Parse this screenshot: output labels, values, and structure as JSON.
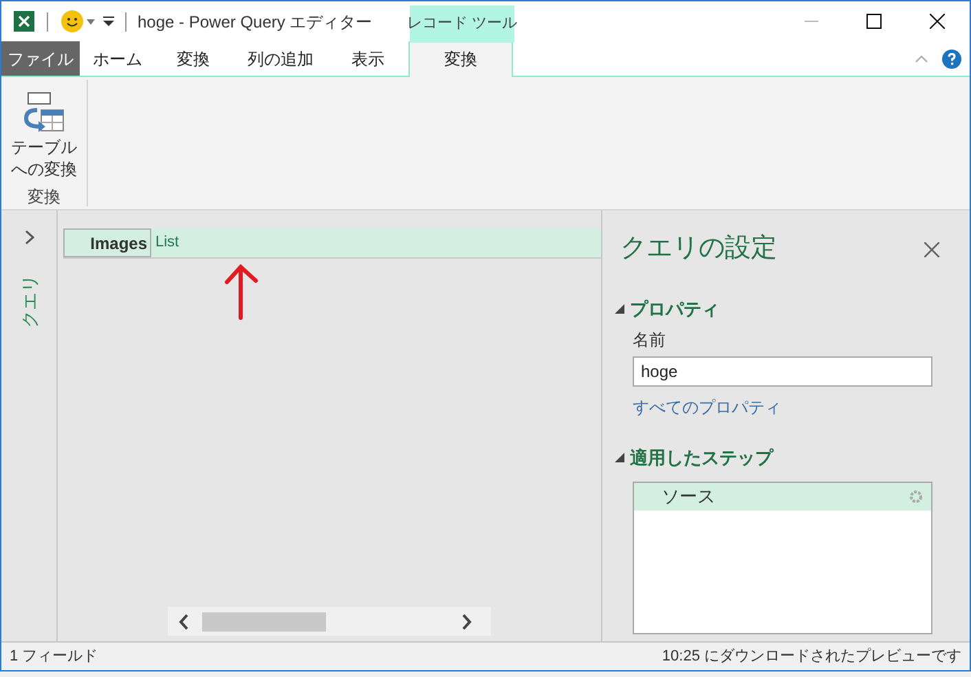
{
  "window": {
    "title": "hoge - Power Query エディター",
    "context_tab": "レコード ツール"
  },
  "tabs": [
    {
      "label": "ファイル",
      "kind": "file",
      "selected": false
    },
    {
      "label": "ホーム",
      "kind": "tab",
      "selected": false
    },
    {
      "label": "変換",
      "kind": "tab",
      "selected": false
    },
    {
      "label": "列の追加",
      "kind": "tab",
      "selected": false
    },
    {
      "label": "表示",
      "kind": "tab",
      "selected": false
    },
    {
      "label": "変換",
      "kind": "context",
      "selected": true
    }
  ],
  "ribbon": {
    "buttons": [
      {
        "lines": [
          "テーブル",
          "への変換"
        ]
      }
    ],
    "group_label": "変換"
  },
  "queries_pane": {
    "label": "クエリ"
  },
  "record": {
    "fields": [
      {
        "name": "Images",
        "value": "List"
      }
    ]
  },
  "settings": {
    "title": "クエリの設定",
    "properties": {
      "heading": "プロパティ",
      "expanded": true,
      "name_label": "名前",
      "name_value": "hoge",
      "link": "すべてのプロパティ"
    },
    "steps": {
      "heading": "適用したステップ",
      "expanded": true,
      "items": [
        {
          "label": "ソース",
          "selected": true
        }
      ]
    }
  },
  "status_bar": {
    "left": "1 フィールド",
    "right": "10:25 にダウンロードされたプレビューです"
  }
}
